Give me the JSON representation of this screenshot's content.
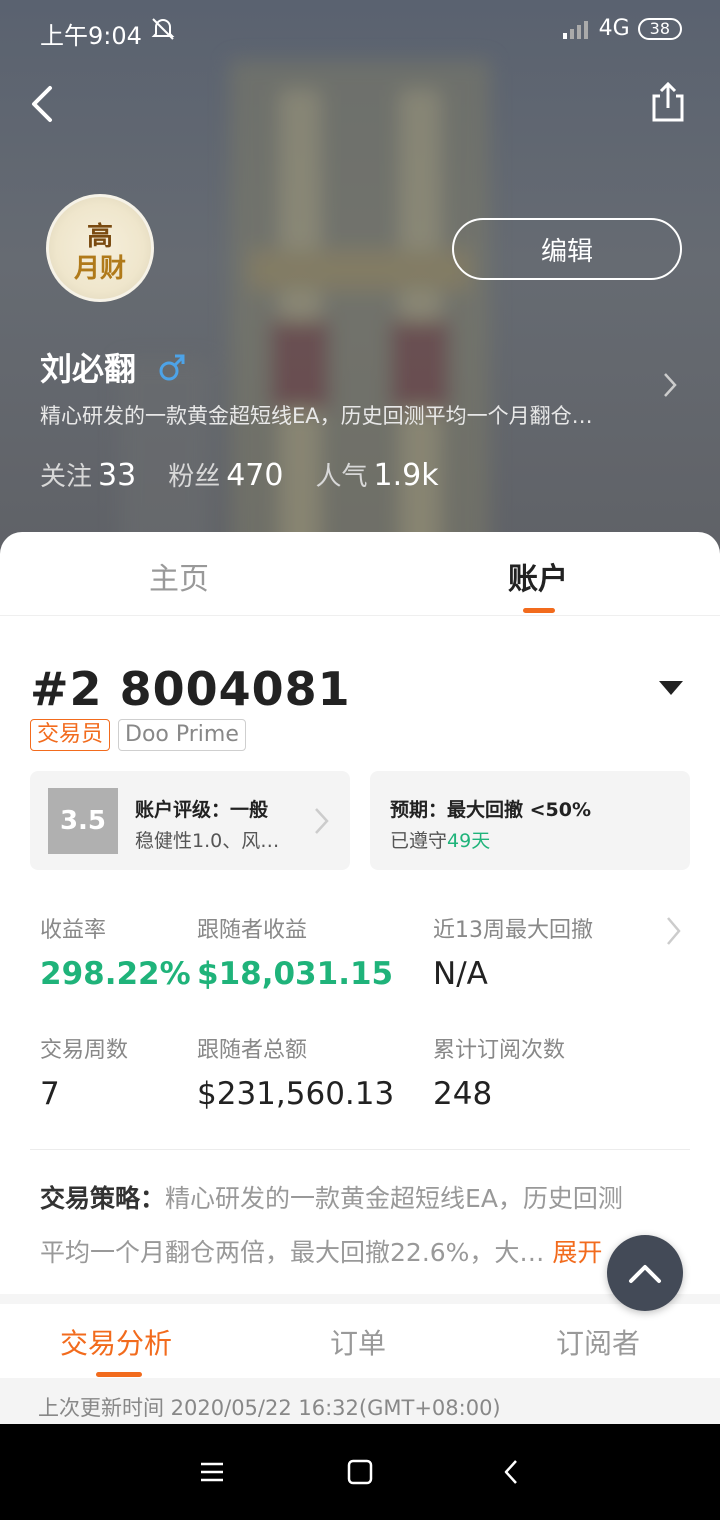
{
  "status_bar": {
    "time": "上午9:04",
    "network": "4G",
    "battery": "38"
  },
  "profile": {
    "name": "刘必翻",
    "bio": "精心研发的一款黄金超短线EA，历史回测平均一个月翻仓…",
    "edit_label": "编辑",
    "stats": [
      {
        "label": "关注",
        "value": "33"
      },
      {
        "label": "粉丝",
        "value": "470"
      },
      {
        "label": "人气",
        "value": "1.9k"
      }
    ]
  },
  "main_tabs": {
    "home": "主页",
    "account": "账户"
  },
  "account": {
    "id": "#2 8004081",
    "tags": {
      "role": "交易员",
      "broker": "Doo Prime"
    },
    "rating": {
      "score": "3.5",
      "title": "账户评级：一般",
      "detail": "稳健性1.0、风…"
    },
    "expectation": {
      "title": "预期：最大回撤 <50%",
      "prefix": "已遵守",
      "days": "49天"
    },
    "metrics": {
      "return_rate": {
        "label": "收益率",
        "value": "298.22%"
      },
      "follower_profit": {
        "label": "跟随者收益",
        "value": "$18,031.15"
      },
      "max_drawdown": {
        "label": "近13周最大回撤",
        "value": "N/A"
      },
      "trade_weeks": {
        "label": "交易周数",
        "value": "7"
      },
      "follower_total": {
        "label": "跟随者总额",
        "value": "$231,560.13"
      },
      "subscriptions": {
        "label": "累计订阅次数",
        "value": "248"
      }
    },
    "strategy": {
      "label": "交易策略：",
      "line1": "精心研发的一款黄金超短线EA，历史回测",
      "line2": "平均一个月翻仓两倍，最大回撤22.6%，大…",
      "expand": "展开"
    }
  },
  "sub_tabs": {
    "analysis": "交易分析",
    "orders": "订单",
    "subscribers": "订阅者"
  },
  "update_time": "上次更新时间 2020/05/22 16:32(GMT+08:00)",
  "colors": {
    "accent": "#f26b1d",
    "positive": "#1fb37a",
    "male": "#4da3e8"
  }
}
